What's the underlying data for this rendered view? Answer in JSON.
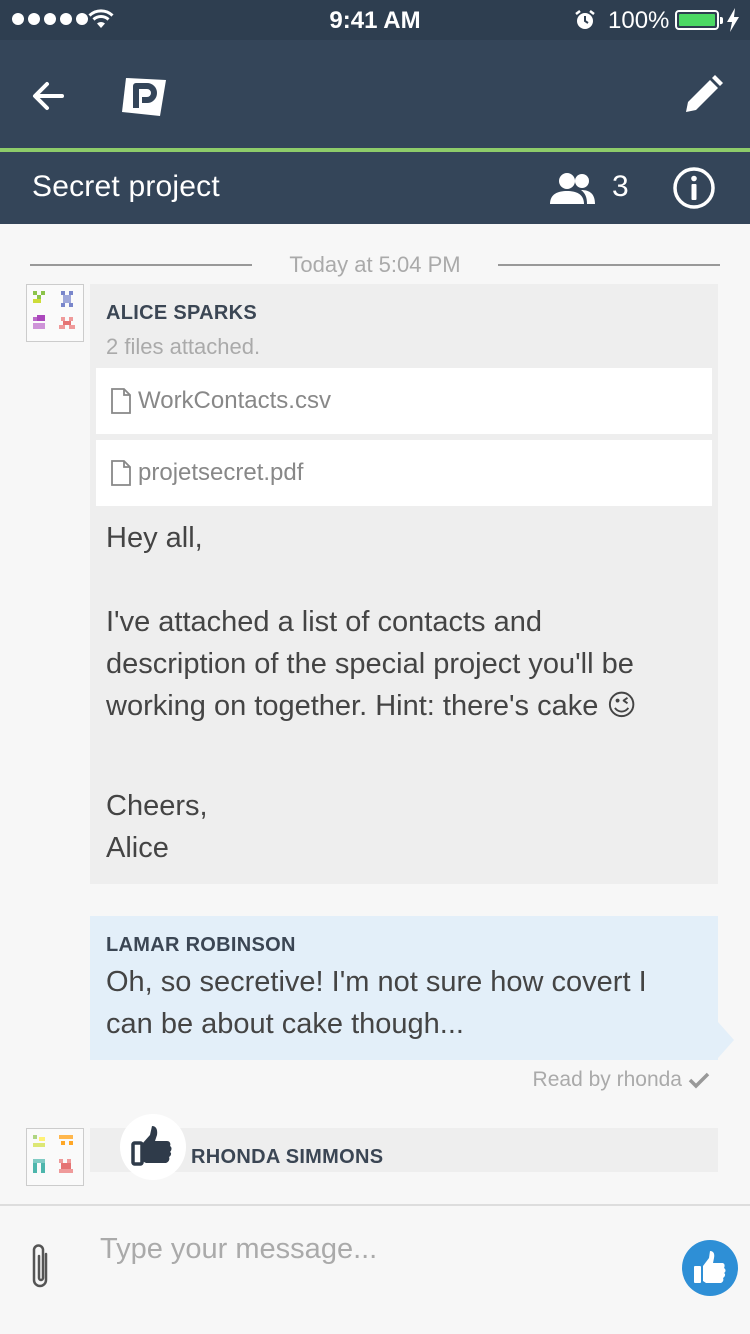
{
  "status_bar": {
    "time": "9:41 AM",
    "battery": "100%"
  },
  "conversation": {
    "title": "Secret project",
    "member_count": "3"
  },
  "date_divider": "Today at 5:04 PM",
  "messages": [
    {
      "sender": "ALICE SPARKS",
      "files_note": "2 files attached.",
      "files": [
        "WorkContacts.csv",
        "projetsecret.pdf"
      ],
      "body": {
        "line1": "Hey all,",
        "line2": "I've attached a list of contacts and",
        "line3": "description of the special project you'll be",
        "line4": "working on together. Hint: there's cake",
        "emoji": "😉",
        "line5": "Cheers,",
        "line6": "Alice"
      }
    },
    {
      "sender": "LAMAR ROBINSON",
      "body": {
        "line1": "Oh, so secretive! I'm not sure how covert I",
        "line2": "can be about cake though..."
      },
      "read_by": "Read by rhonda"
    },
    {
      "sender": "RHONDA SIMMONS"
    }
  ],
  "composer": {
    "placeholder": "Type your message..."
  },
  "colors": {
    "header": "#344559",
    "accent": "#8ecc6a",
    "bubble_self": "#e3eff9",
    "send_button": "#2e8fd6"
  }
}
